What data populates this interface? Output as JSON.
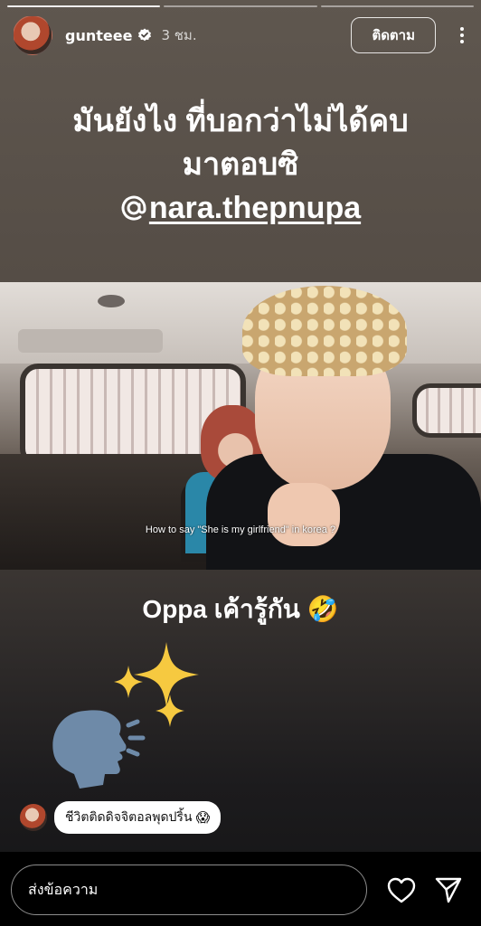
{
  "header": {
    "username": "gunteee",
    "time": "3 ชม.",
    "follow_label": "ติดตาม",
    "progress_segments": 3,
    "progress_active_index": 1
  },
  "caption": {
    "line1": "มันยังไง ที่บอกว่าไม่ได้คบ",
    "line2": "มาตอบซิ",
    "mention": "nara.thepnupa"
  },
  "video": {
    "subtitle": "How to say \"She is my girlfriend\" in korea ?"
  },
  "text_sticker": {
    "text": "Oppa เค้ารู้กัน",
    "emoji": "🤣"
  },
  "reply": {
    "text": "ชีวิตติดดิจจิตอลพุดปริ้น",
    "emoji": "😱"
  },
  "footer": {
    "message_placeholder": "ส่งข้อความ"
  },
  "colors": {
    "accent": "#ffffff",
    "background_top": "#5f574f",
    "background_bottom": "#141415"
  },
  "icons": [
    "verified-badge-icon",
    "more-options-icon",
    "mention-icon",
    "heart-icon",
    "send-icon",
    "speaking-head-icon",
    "sparkles-icon"
  ]
}
